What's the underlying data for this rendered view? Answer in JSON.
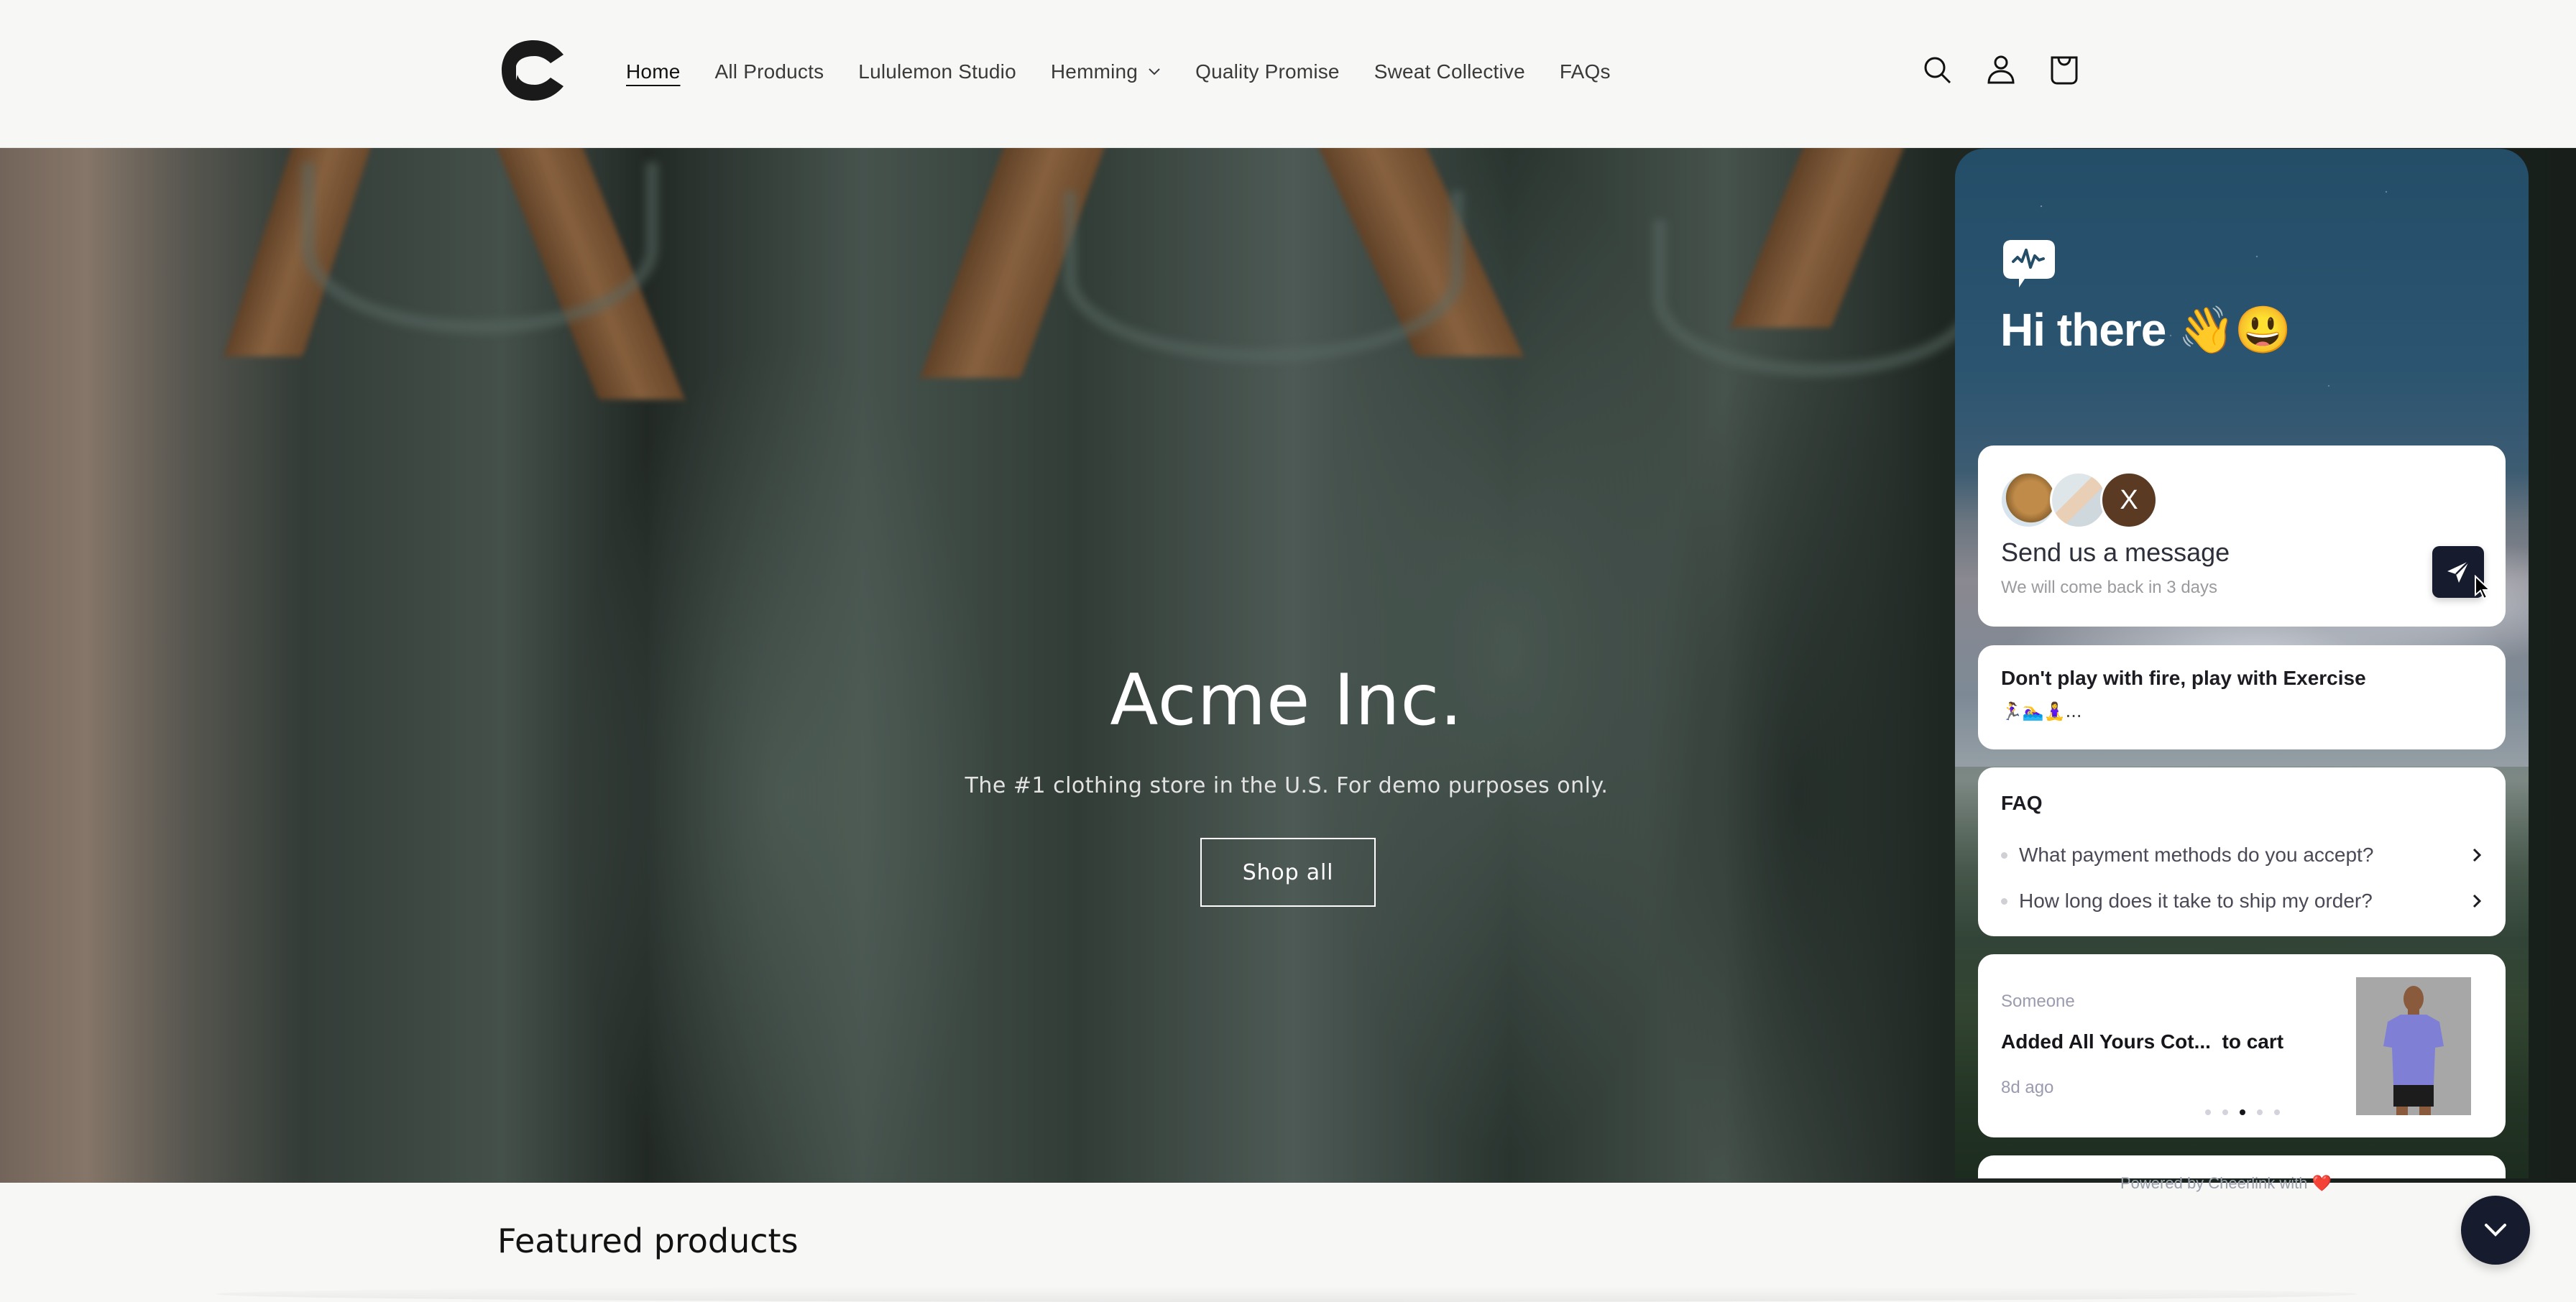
{
  "header": {
    "logo_alt": "C logo",
    "nav": [
      {
        "label": "Home",
        "active": true
      },
      {
        "label": "All Products"
      },
      {
        "label": "Lululemon Studio"
      },
      {
        "label": "Hemming",
        "has_dropdown": true
      },
      {
        "label": "Quality Promise"
      },
      {
        "label": "Sweat Collective"
      },
      {
        "label": "FAQs"
      }
    ],
    "icons": [
      "search-icon",
      "account-icon",
      "cart-icon"
    ]
  },
  "hero": {
    "title": "Acme Inc.",
    "subtitle": "The #1 clothing store in the U.S. For demo purposes only.",
    "button_label": "Shop all"
  },
  "featured": {
    "heading": "Featured products"
  },
  "chat_widget": {
    "greeting": "Hi there 👋😃",
    "send_card": {
      "avatars": [
        "cat-photo",
        "woman-photo",
        "X"
      ],
      "title": "Send us a message",
      "subtitle": "We will come back in 3 days"
    },
    "promo_card": {
      "title": "Don't play with fire, play with Exercise",
      "subtitle": "🏃‍♀️🏊‍♀️🧘‍♀️..."
    },
    "faq_card": {
      "title": "FAQ",
      "items": [
        "What payment methods do you accept?",
        "How long does it take to ship my order?"
      ]
    },
    "activity_card": {
      "who": "Someone",
      "action": "Added All Yours Cot...  to cart",
      "time": "8d ago",
      "pager_total": 5,
      "pager_active": 3
    },
    "powered_by": "Powered by Cheerlink with ❤️",
    "colors": {
      "accent": "#171b2e",
      "card": "#ffffff"
    }
  }
}
